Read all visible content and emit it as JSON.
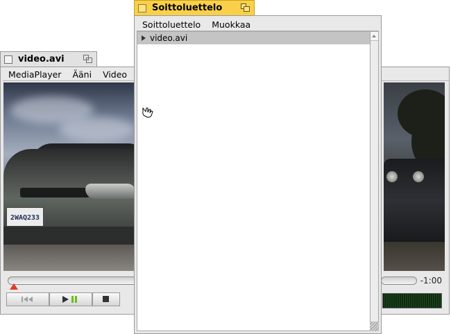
{
  "windows": {
    "video": {
      "title": "video.avi",
      "menu": [
        "MediaPlayer",
        "Ääni",
        "Video"
      ],
      "plate_text": "2WAQ233",
      "time_remaining": "-1:00",
      "position": 0.0
    },
    "playlist": {
      "title": "Soittoluettelo",
      "menu": [
        "Soittoluettelo",
        "Muokkaa"
      ],
      "items": [
        {
          "label": "video.avi",
          "selected": true
        }
      ]
    }
  },
  "icons": {
    "prev": "skip-back-icon",
    "play_pause": "play-pause-icon",
    "stop": "stop-icon",
    "close": "close-box-icon",
    "zoom": "zoom-box-icon",
    "cursor": "hand-pointer-icon"
  },
  "colors": {
    "active_tab": "#f8d04a",
    "inactive_tab": "#e2e2e2",
    "selection": "#c4c4c4",
    "seek_thumb": "#e23a2a",
    "pause_green": "#6bbf1a"
  }
}
